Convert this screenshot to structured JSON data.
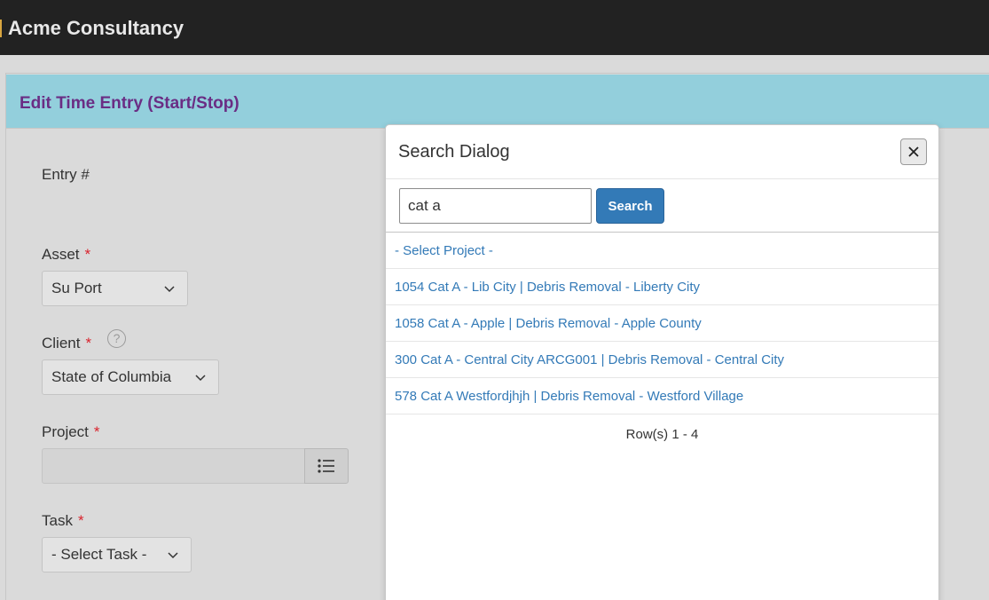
{
  "app": {
    "title": "Acme Consultancy"
  },
  "page": {
    "title": "Edit Time Entry (Start/Stop)"
  },
  "form": {
    "entry_label": "Entry #",
    "asset_label": "Asset",
    "asset_value": "Su Port",
    "client_label": "Client",
    "client_value": "State of Columbia",
    "project_label": "Project",
    "task_label": "Task",
    "task_value": "- Select Task -",
    "required_mark": "*",
    "help_glyph": "?"
  },
  "dialog": {
    "title": "Search Dialog",
    "search_value": "cat a",
    "search_button": "Search",
    "results": [
      "- Select Project -",
      "1054 Cat A - Lib City | Debris Removal - Liberty City",
      "1058 Cat A - Apple | Debris Removal - Apple County",
      "300 Cat A - Central City ARCG001 | Debris Removal - Central City",
      "578 Cat A Westfordjhjh | Debris Removal - Westford Village"
    ],
    "row_count": "Row(s) 1 - 4"
  },
  "icons": {
    "close": "close-icon",
    "list": "list-icon",
    "chevron": "chevron-down-icon",
    "help": "help-circle-icon"
  },
  "colors": {
    "header_bar": "#222222",
    "panel_header": "#93cfdc",
    "title_purple": "#6a2d84",
    "link_blue": "#337ab7",
    "required_red": "#d9232d"
  }
}
